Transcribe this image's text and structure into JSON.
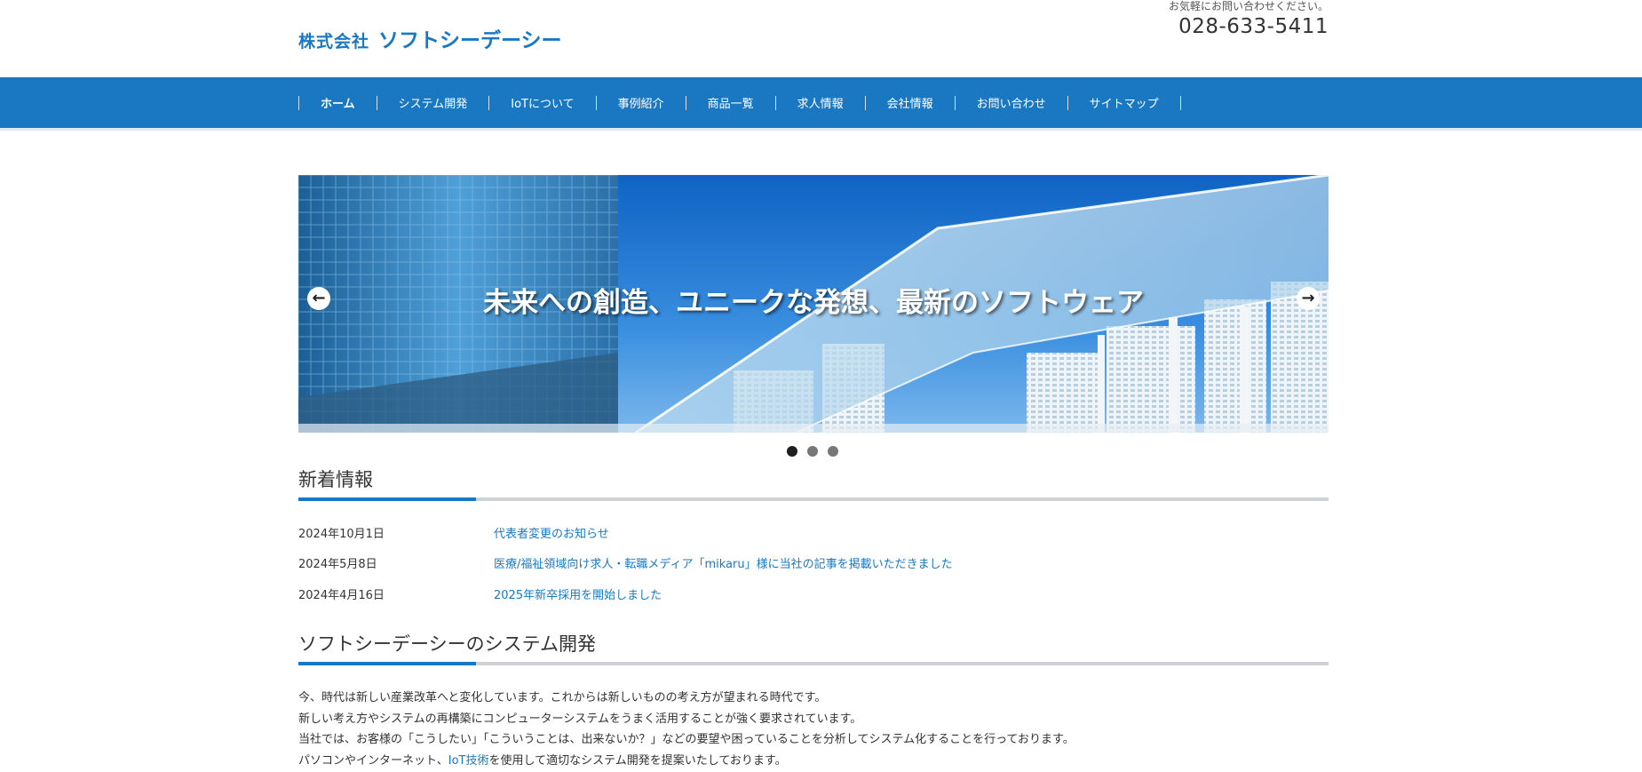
{
  "header": {
    "logo_prefix": "株式会社",
    "logo_name": "ソフトシーデーシー",
    "contact_note": "お気軽にお問い合わせください。",
    "phone": "028-633-5411"
  },
  "nav": {
    "items": [
      {
        "label": "ホーム"
      },
      {
        "label": "システム開発"
      },
      {
        "label": "IoTについて"
      },
      {
        "label": "事例紹介"
      },
      {
        "label": "商品一覧"
      },
      {
        "label": "求人情報"
      },
      {
        "label": "会社情報"
      },
      {
        "label": "お問い合わせ"
      },
      {
        "label": "サイトマップ"
      }
    ]
  },
  "slider": {
    "caption": "未来への創造、ユニークな発想、最新のソフトウェア",
    "prev_icon": "arrow-left-icon",
    "next_icon": "arrow-right-icon",
    "dot_count": 3,
    "active_index": 0
  },
  "news": {
    "title": "新着情報",
    "items": [
      {
        "date": "2024年10月1日",
        "text": "代表者変更のお知らせ"
      },
      {
        "date": "2024年5月8日",
        "text": "医療/福祉領域向け求人・転職メディア「mikaru」様に当社の記事を掲載いただきました"
      },
      {
        "date": "2024年4月16日",
        "text": "2025年新卒採用を開始しました"
      }
    ]
  },
  "system": {
    "title": "ソフトシーデーシーのシステム開発",
    "line1": "今、時代は新しい産業改革へと変化しています。これからは新しいものの考え方が望まれる時代です。",
    "line2": "新しい考え方やシステムの再構築にコンピューターシステムをうまく活用することが強く要求されています。",
    "line3": "当社では、お客様の「こうしたい」「こういうことは、出来ないか？」などの要望や困っていることを分析してシステム化することを行っております。",
    "line4_prefix": "パソコンやインターネット、",
    "line4_link": "IoT技術",
    "line4_suffix": "を使用して適切なシステム開発を提案いたしております。"
  },
  "colors": {
    "brand": "#1a78c2",
    "text": "#333333",
    "divider": "#cfd3d6"
  }
}
